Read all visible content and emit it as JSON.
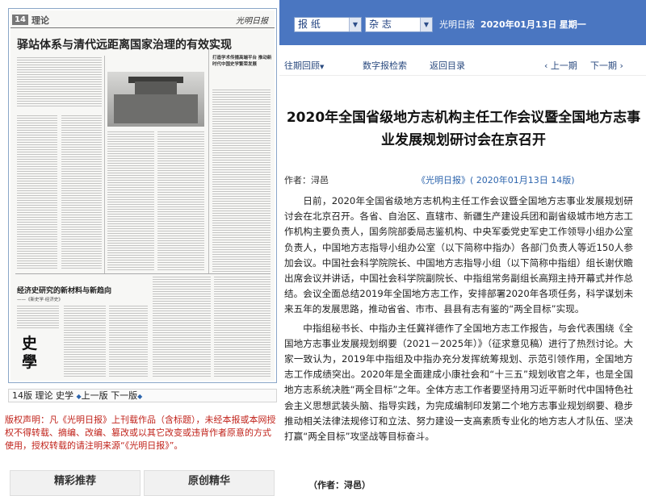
{
  "paper_preview": {
    "page_no": "14",
    "section": "理论",
    "masthead": "光明日报",
    "headline": "驿站体系与清代远距离国家治理的有效实现",
    "right_tag": "",
    "right_headline": "打造学术传播高端平台 推动新时代中国史学繁荣发展",
    "head2_tag": "",
    "head2": "经济史研究的新材料与新趋向",
    "sub2": "——《新史学·经济史》",
    "calligraphy": [
      "史",
      "學"
    ]
  },
  "page_nav": {
    "label": "14版 理论 史学",
    "prev": "上一版",
    "next": "下一版"
  },
  "copyright": "版权声明：凡《光明日报》上刊载作品（含标题），未经本报或本网授权不得转载、摘编、改编、篡改或以其它改变或违背作者原意的方式使用，授权转载的请注明来源“《光明日报》”。",
  "tabs": [
    "精彩推荐",
    "原创精华"
  ],
  "topbar": {
    "select_paper": "报  纸",
    "select_magazine": "杂  志",
    "paper_name": "光明日报",
    "date": "2020年01月13日",
    "weekday": "星期一"
  },
  "nav": {
    "back": "往期回顾",
    "search": "数字报检索",
    "directory": "返回目录",
    "prev": "上一期",
    "next": "下一期"
  },
  "article": {
    "title": "2020年全国省级地方志机构主任工作会议暨全国地方志事业发展规划研讨会在京召开",
    "author": "作者：浔邑",
    "source": "《光明日报》( 2020年01月13日 14版)",
    "paragraphs": [
      "日前，2020年全国省级地方志机构主任工作会议暨全国地方志事业发展规划研讨会在北京召开。各省、自治区、直辖市、新疆生产建设兵团和副省级城市地方志工作机构主要负责人，国务院部委局志鉴机构、中央军委党史军史工作领导小组办公室负责人，中国地方志指导小组办公室（以下简称中指办）各部门负责人等近150人参加会议。中国社会科学院院长、中国地方志指导小组（以下简称中指组）组长谢伏瞻出席会议并讲话，中国社会科学院副院长、中指组常务副组长高翔主持开幕式并作总结。会议全面总结2019年全国地方志工作，安排部署2020年各项任务，科学谋划未来五年的发展思路，推动省省、市市、县县有志有鉴的“两全目标”实现。",
      "中指组秘书长、中指办主任冀祥德作了全国地方志工作报告，与会代表围绕《全国地方志事业发展规划纲要（2021－2025年）》（征求意见稿）进行了热烈讨论。大家一致认为，2019年中指组及中指办充分发挥统筹规划、示范引领作用，全国地方志工作成绩突出。2020年是全面建成小康社会和“十三五”规划收官之年，也是全国地方志系统决胜“两全目标”之年。全体方志工作者要坚持用习近平新时代中国特色社会主义思想武装头脑、指导实践，为完成编制印发第二个地方志事业规划纲要、稳步推动相关法律法规修订和立法、努力建设一支高素质专业化的地方志人才队伍、坚决打赢“两全目标”攻坚战等目标奋斗。"
    ],
    "sign_off": "（作者：浔邑）"
  }
}
